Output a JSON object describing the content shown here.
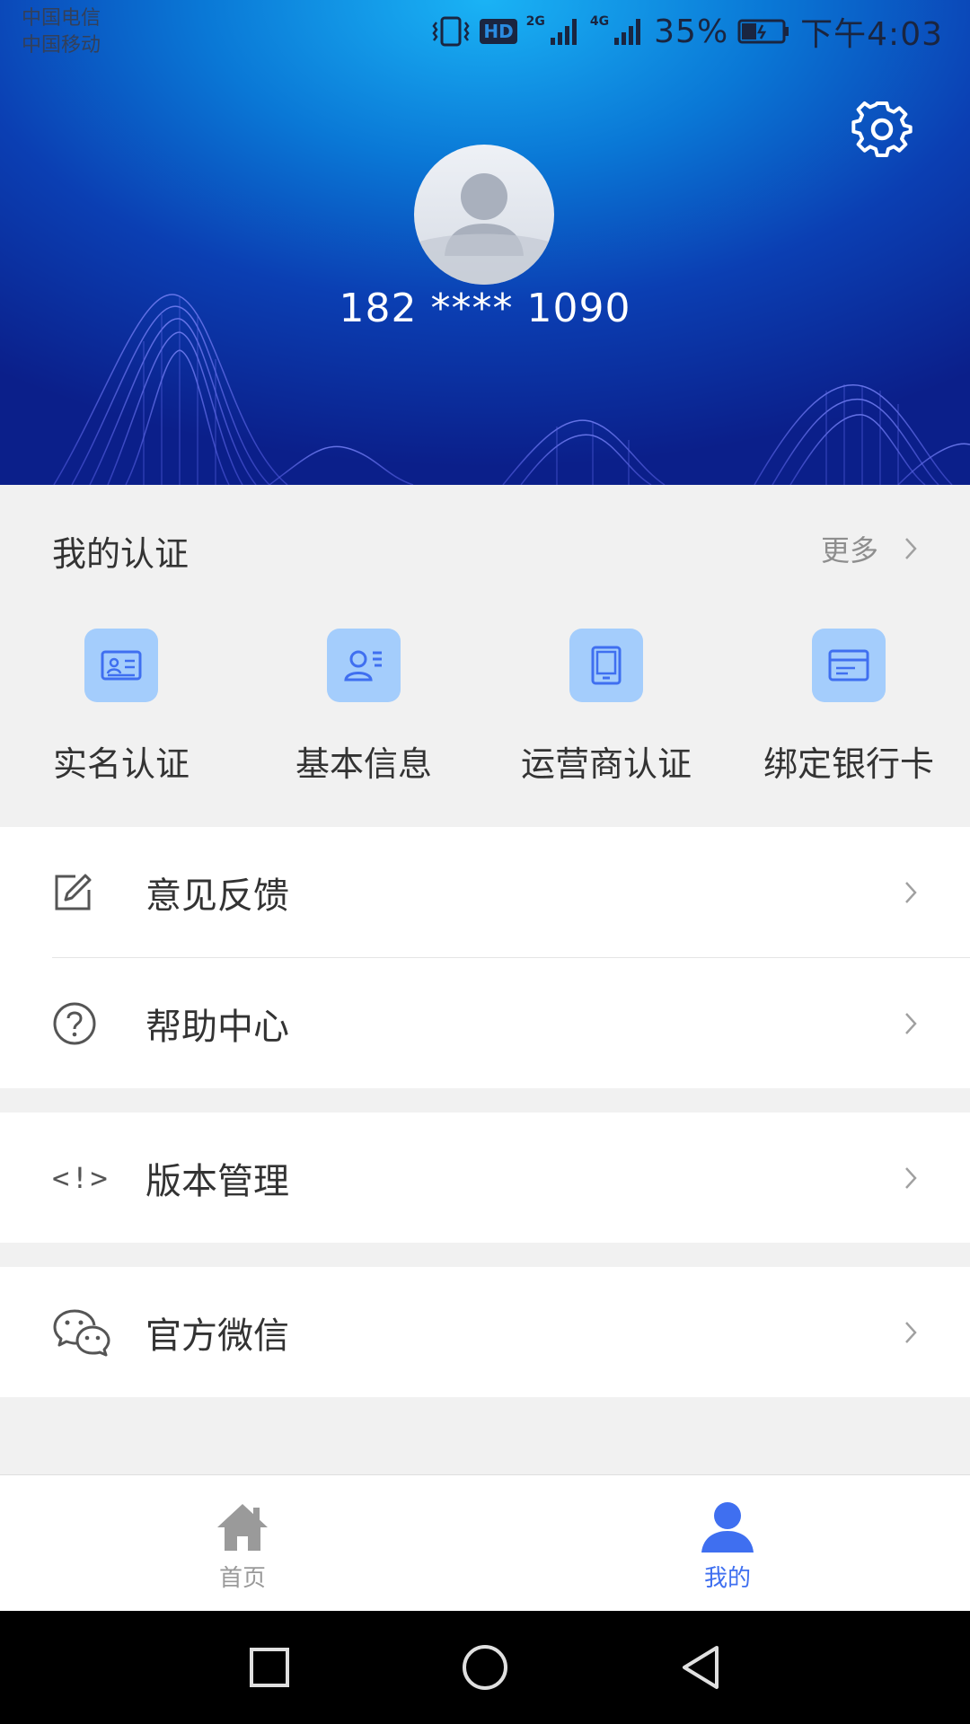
{
  "status_bar": {
    "carrier_1": "中国电信",
    "carrier_2": "中国移动",
    "hd_badge": "HD",
    "network_1": "2G",
    "network_2": "4G",
    "battery": "35%",
    "time": "下午4:03"
  },
  "profile": {
    "phone": "182 **** 1090"
  },
  "certification": {
    "title": "我的认证",
    "more_label": "更多",
    "items": [
      {
        "label": "实名认证",
        "icon": "id-card-icon"
      },
      {
        "label": "基本信息",
        "icon": "user-info-icon"
      },
      {
        "label": "运营商认证",
        "icon": "phone-device-icon"
      },
      {
        "label": "绑定银行卡",
        "icon": "bank-card-icon"
      }
    ]
  },
  "menu": {
    "feedback": "意见反馈",
    "help": "帮助中心",
    "version": "版本管理",
    "version_icon_text": "<!>",
    "wechat": "官方微信"
  },
  "tabbar": {
    "home": "首页",
    "mine": "我的",
    "active": "mine",
    "active_color": "#3f6ff0",
    "inactive_color": "#9a9a9a"
  },
  "colors": {
    "header_gradient": [
      "#1ab3f5",
      "#0b1f8a"
    ],
    "cert_icon_bg": "#a4cdfc",
    "cert_icon_fg": "#3f6ff0"
  }
}
